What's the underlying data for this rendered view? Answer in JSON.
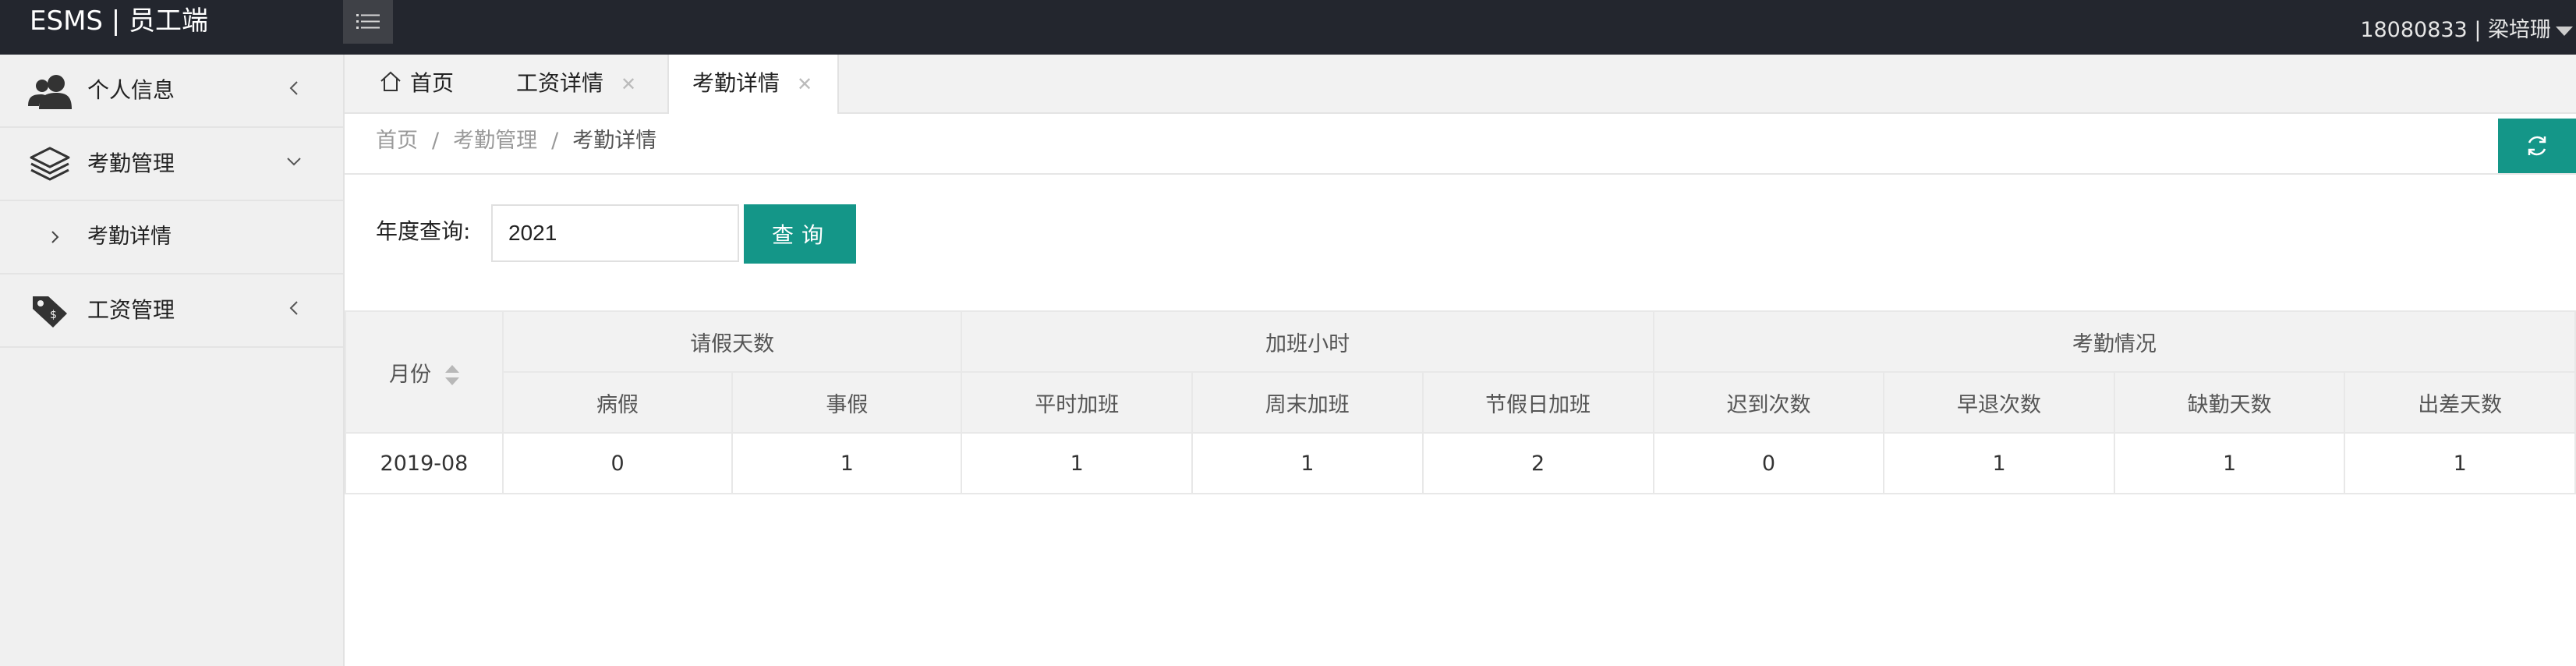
{
  "header": {
    "logo": "ESMS | 员工端",
    "user": "18080833 | 梁培珊",
    "menu_toggle_icon": "list-icon"
  },
  "sidebar": {
    "items": [
      {
        "label": "个人信息",
        "icon": "user-icon",
        "chevron": "chevron-left-icon"
      },
      {
        "label": "考勤管理",
        "icon": "layers-icon",
        "chevron": "chevron-down-icon",
        "children": [
          {
            "label": "考勤详情",
            "icon": "chevron-right-icon"
          }
        ]
      },
      {
        "label": "工资管理",
        "icon": "tag-icon",
        "chevron": "chevron-left-icon"
      }
    ]
  },
  "tabs": [
    {
      "label": "首页",
      "icon": "home-icon"
    },
    {
      "label": "工资详情",
      "closable": true
    },
    {
      "label": "考勤详情",
      "closable": true,
      "active": true
    }
  ],
  "breadcrumb": [
    "首页",
    "考勤管理",
    "考勤详情"
  ],
  "query": {
    "label": "年度查询:",
    "value": "2021",
    "button": "查询"
  },
  "table": {
    "group_headers": {
      "month": "月份",
      "leave": "请假天数",
      "overtime": "加班小时",
      "attendance": "考勤情况"
    },
    "sub_headers": [
      "病假",
      "事假",
      "平时加班",
      "周末加班",
      "节假日加班",
      "迟到次数",
      "早退次数",
      "缺勤天数",
      "出差天数"
    ],
    "rows": [
      {
        "month": "2019-08",
        "cells": [
          "0",
          "1",
          "1",
          "1",
          "2",
          "0",
          "1",
          "1",
          "1"
        ]
      }
    ]
  },
  "colors": {
    "header_bg": "#23262e",
    "accent": "#149688",
    "sidebar_bg": "#f0f0f0"
  }
}
